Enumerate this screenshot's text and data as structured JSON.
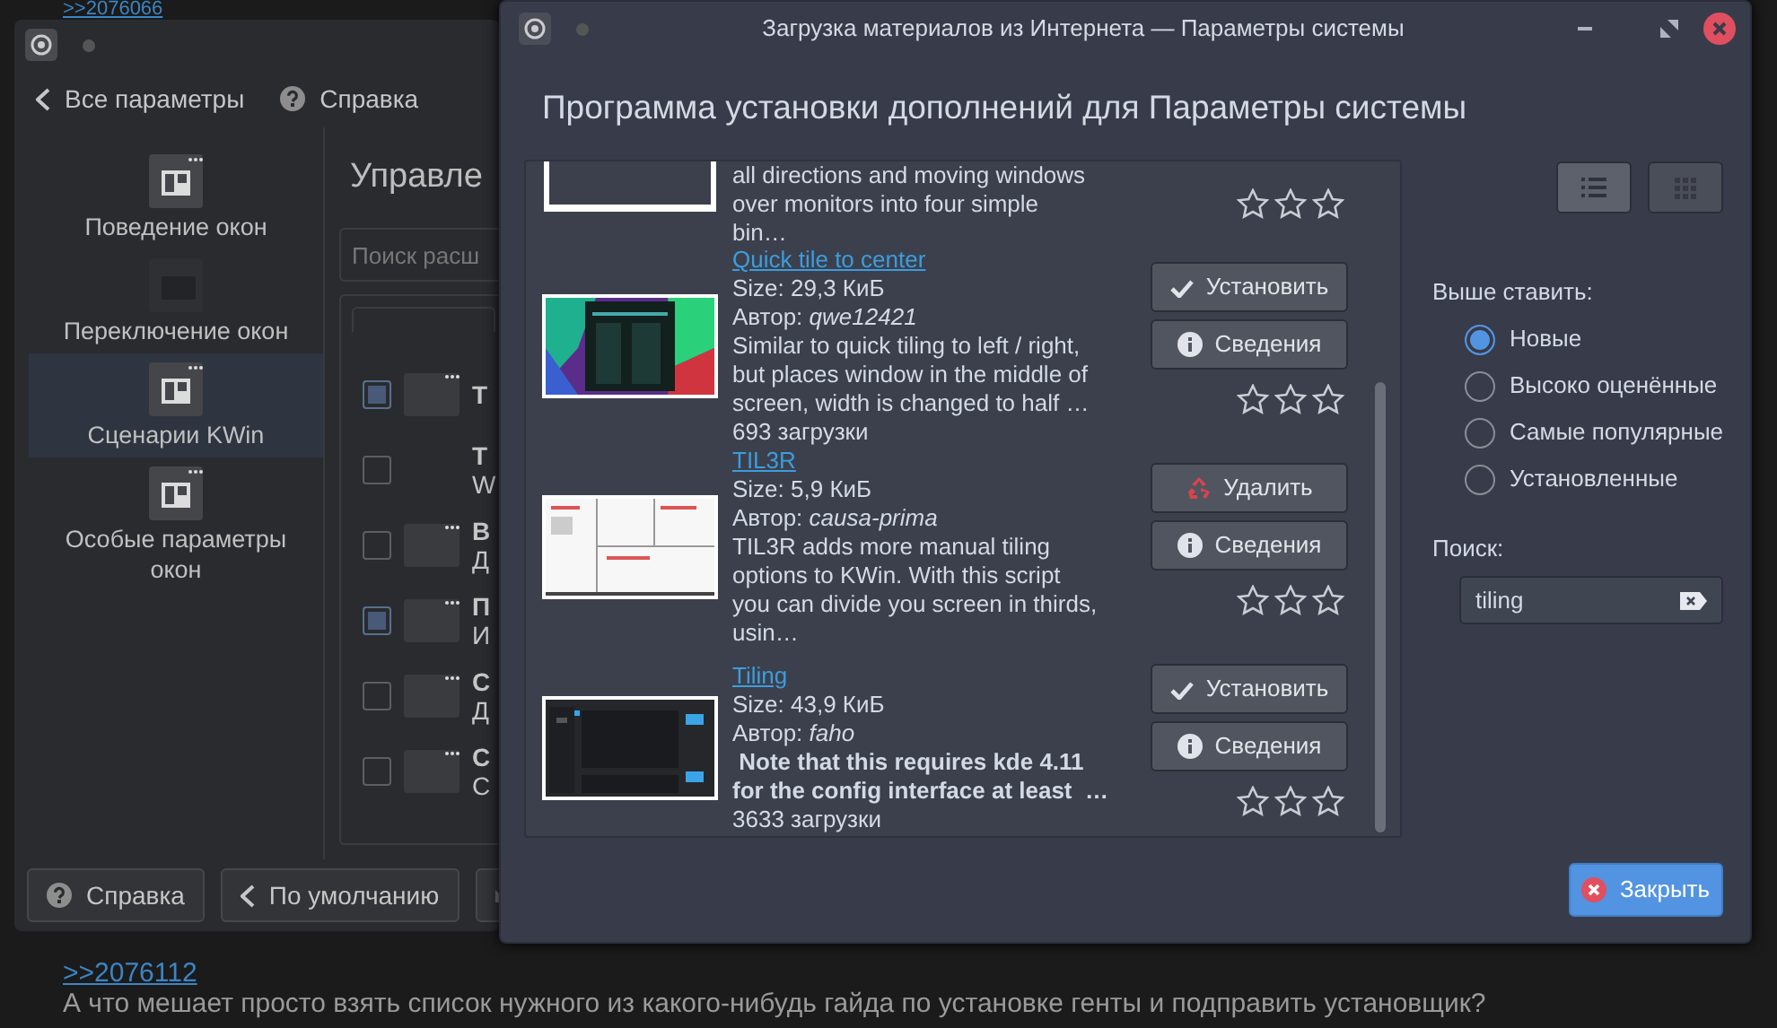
{
  "background_page": {
    "posts": [
      {
        "link": ">>2076066"
      },
      {
        "link": ">>2076112",
        "text": "А что мешает просто взять список нужного из какого-нибудь гайда по установке генты и подправить установщик?"
      }
    ]
  },
  "settings_window": {
    "toolbar": [
      {
        "kind": "back",
        "label": "Все параметры"
      },
      {
        "kind": "help",
        "label": "Справка"
      }
    ],
    "sidebar": [
      {
        "label": "Поведение окон",
        "selected": false
      },
      {
        "label": "Переключение окон",
        "selected": false
      },
      {
        "label": "Сценарии KWin",
        "selected": true
      },
      {
        "label": "Особые параметры окон",
        "selected": false
      }
    ],
    "heading": "Управле",
    "search": {
      "placeholder": "Поиск расш"
    },
    "scripts": [
      {
        "checked": true,
        "thumbnail": true,
        "title": "T"
      },
      {
        "checked": false,
        "thumbnail": false,
        "title": "T",
        "subtitle": "W"
      },
      {
        "checked": false,
        "thumbnail": true,
        "title": "В",
        "subtitle": "Д"
      },
      {
        "checked": true,
        "thumbnail": true,
        "title": "П",
        "subtitle": "И"
      },
      {
        "checked": false,
        "thumbnail": true,
        "title": "С",
        "subtitle": "Д"
      },
      {
        "checked": false,
        "thumbnail": true,
        "title": "С",
        "subtitle": "С"
      }
    ],
    "buttons": [
      {
        "kind": "help",
        "label": "Справка"
      },
      {
        "kind": "back",
        "label": "По умолчанию"
      },
      {
        "kind": "reset"
      }
    ]
  },
  "dialog": {
    "title": "Загрузка материалов из Интернета — Параметры системы",
    "heading": "Программа установки дополнений для Параметры системы",
    "items": [
      {
        "thumbnail": {
          "kind": "picture"
        },
        "description": [
          "all directions and moving windows",
          "over monitors into four simple",
          "bin…"
        ],
        "stars": 0
      },
      {
        "title": "Quick tile to center",
        "size": "Size: 29,3 КиБ",
        "author": "Автор: *qwe12421*",
        "thumbnail": {
          "kind": "picture"
        },
        "description": [
          "Similar to quick tiling to left / right,",
          "but places window in the middle of",
          "screen, width is changed to half …"
        ],
        "bold": false,
        "downloads": "693 загрузки",
        "buttons": [
          {
            "kind": "install",
            "label": "Установить"
          },
          {
            "kind": "details",
            "label": "Сведения"
          }
        ],
        "stars": 0
      },
      {
        "title": "TIL3R",
        "size": "Size: 5,9 КиБ",
        "author": "Автор: *causa-prima*",
        "thumbnail": {
          "kind": "picture"
        },
        "description": [
          "TIL3R adds more manual tiling",
          "options to KWin. With this script",
          "you can divide you screen in thirds,",
          "usin…"
        ],
        "bold": false,
        "buttons": [
          {
            "kind": "remove",
            "label": "Удалить"
          },
          {
            "kind": "details",
            "label": "Сведения"
          }
        ],
        "stars": 0
      },
      {
        "title": "Tiling",
        "size": "Size: 43,9 КиБ",
        "author": "Автор: *faho*",
        "thumbnail": {
          "kind": "picture"
        },
        "description": [
          " Note that this requires kde 4.11",
          "for the config interface at least  …"
        ],
        "bold": true,
        "downloads": "3633 загрузки",
        "buttons": [
          {
            "kind": "install",
            "label": "Установить"
          },
          {
            "kind": "details",
            "label": "Сведения"
          }
        ],
        "stars": 0
      }
    ],
    "view_modes": [
      {
        "kind": "list",
        "selected": true
      },
      {
        "kind": "grid",
        "selected": false
      }
    ],
    "sort": {
      "label": "Выше ставить:",
      "options": [
        {
          "label": "Новые",
          "selected": true
        },
        {
          "label": "Высоко оценённые",
          "selected": false
        },
        {
          "label": "Самые популярные",
          "selected": false
        },
        {
          "label": "Установленные",
          "selected": false
        }
      ]
    },
    "search": {
      "label": "Поиск:",
      "value": "tiling"
    },
    "close_button": "Закрыть"
  }
}
